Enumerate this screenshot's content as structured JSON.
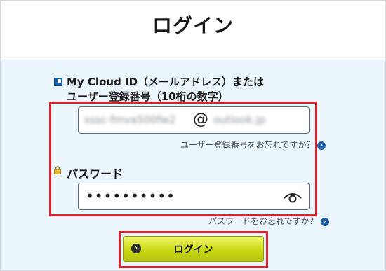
{
  "page": {
    "title": "ログイン"
  },
  "form": {
    "id_label_line1": "My Cloud ID（メールアドレス）または",
    "id_label_line2": "ユーザー登録番号（10桁の数字）",
    "id_value_local": "sssc-fmva500fw2",
    "id_value_at": "@",
    "id_value_domain": "outlook.jp",
    "forgot_id_link": "ユーザー登録番号をお忘れですか？",
    "password_label": "パスワード",
    "password_value": "••••••••••",
    "forgot_password_link": "パスワードをお忘れですか？",
    "login_button": "ログイン"
  },
  "icons": {
    "id": "id-card-icon",
    "lock": "lock-icon",
    "eye": "eye-icon",
    "arrow": "arrow-right-icon"
  },
  "colors": {
    "highlight": "#d8222e",
    "button": "#c9d814",
    "link_arrow": "#1f5ea3",
    "content_bg": "#eaf5fc"
  }
}
